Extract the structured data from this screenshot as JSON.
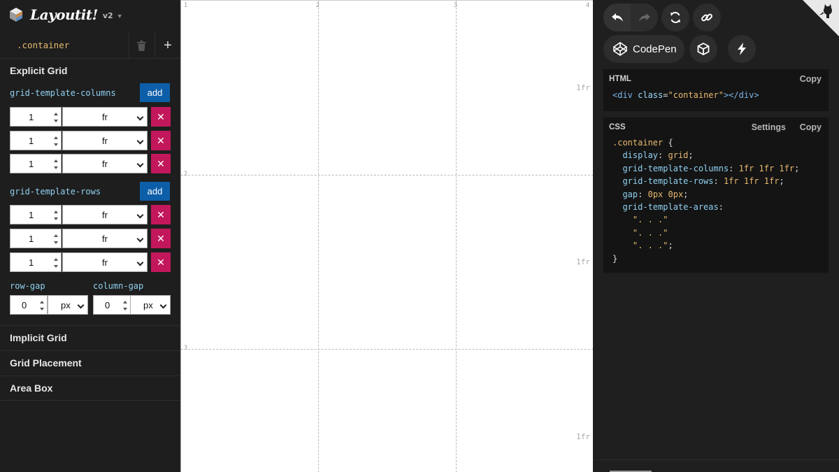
{
  "app": {
    "name": "Layoutit!",
    "version": "v2"
  },
  "selector": {
    "name": ".container"
  },
  "explicit_grid": {
    "title": "Explicit Grid",
    "columns": {
      "label": "grid-template-columns",
      "add_label": "add",
      "tracks": [
        {
          "value": "1",
          "unit": "fr"
        },
        {
          "value": "1",
          "unit": "fr"
        },
        {
          "value": "1",
          "unit": "fr"
        }
      ]
    },
    "rows": {
      "label": "grid-template-rows",
      "add_label": "add",
      "tracks": [
        {
          "value": "1",
          "unit": "fr"
        },
        {
          "value": "1",
          "unit": "fr"
        },
        {
          "value": "1",
          "unit": "fr"
        }
      ]
    },
    "row_gap": {
      "label": "row-gap",
      "value": "0",
      "unit": "px"
    },
    "column_gap": {
      "label": "column-gap",
      "value": "0",
      "unit": "px"
    }
  },
  "sections": [
    "Implicit Grid",
    "Grid Placement",
    "Area Box"
  ],
  "canvas": {
    "column_line_numbers": [
      "1",
      "2",
      "3",
      "4"
    ],
    "row_line_numbers": [
      "2",
      "3"
    ],
    "row_size_labels": [
      "1fr",
      "1fr",
      "1fr"
    ]
  },
  "toolbar": {
    "codepen_label": "CodePen"
  },
  "html_panel": {
    "title": "HTML",
    "copy_label": "Copy",
    "code": {
      "open_tag": "<div",
      "attr": " class",
      "eq": "=",
      "value": "\"container\"",
      "close": "></div>"
    }
  },
  "css_panel": {
    "title": "CSS",
    "settings_label": "Settings",
    "copy_label": "Copy",
    "selector": ".container",
    "open_brace": " {",
    "close_brace": "}",
    "declarations": [
      {
        "prop": "display",
        "value": "grid"
      },
      {
        "prop": "grid-template-columns",
        "value": "1fr 1fr 1fr"
      },
      {
        "prop": "grid-template-rows",
        "value": "1fr 1fr 1fr"
      },
      {
        "prop": "gap",
        "value": "0px 0px"
      }
    ],
    "areas_prop": "grid-template-areas",
    "areas": [
      "\". . .\"",
      "\". . .\"",
      "\". . .\""
    ]
  },
  "colors": {
    "accent_blue": "#0d5ea8",
    "remove_pink": "#c2185b",
    "sidebar_bg": "#1e1e1e",
    "panel_bg": "#1f1f1f",
    "code_bg": "#141414"
  }
}
